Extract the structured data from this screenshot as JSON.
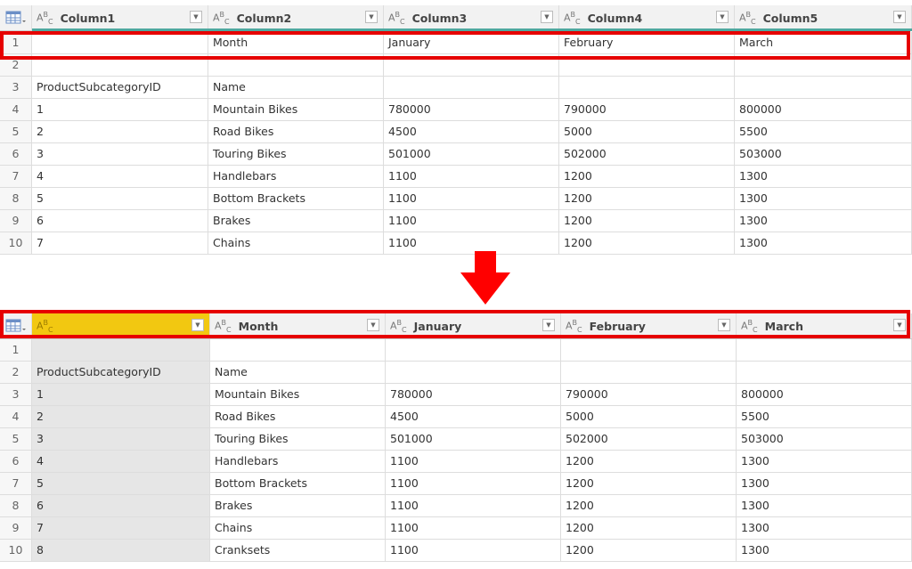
{
  "before": {
    "columns": [
      {
        "type_icon": "abc-text-type-icon",
        "name": "Column1"
      },
      {
        "type_icon": "abc-text-type-icon",
        "name": "Column2"
      },
      {
        "type_icon": "abc-text-type-icon",
        "name": "Column3"
      },
      {
        "type_icon": "abc-text-type-icon",
        "name": "Column4"
      },
      {
        "type_icon": "abc-text-type-icon",
        "name": "Column5"
      }
    ],
    "rows": [
      {
        "n": "1",
        "c": [
          "",
          "Month",
          "January",
          "February",
          "March"
        ]
      },
      {
        "n": "2",
        "c": [
          "",
          "",
          "",
          "",
          ""
        ]
      },
      {
        "n": "3",
        "c": [
          "ProductSubcategoryID",
          "Name",
          "",
          "",
          ""
        ]
      },
      {
        "n": "4",
        "c": [
          "1",
          "Mountain Bikes",
          "780000",
          "790000",
          "800000"
        ]
      },
      {
        "n": "5",
        "c": [
          "2",
          "Road Bikes",
          "4500",
          "5000",
          "5500"
        ]
      },
      {
        "n": "6",
        "c": [
          "3",
          "Touring Bikes",
          "501000",
          "502000",
          "503000"
        ]
      },
      {
        "n": "7",
        "c": [
          "4",
          "Handlebars",
          "1100",
          "1200",
          "1300"
        ]
      },
      {
        "n": "8",
        "c": [
          "5",
          "Bottom Brackets",
          "1100",
          "1200",
          "1300"
        ]
      },
      {
        "n": "9",
        "c": [
          "6",
          "Brakes",
          "1100",
          "1200",
          "1300"
        ]
      },
      {
        "n": "10",
        "c": [
          "7",
          "Chains",
          "1100",
          "1200",
          "1300"
        ]
      }
    ]
  },
  "after": {
    "columns": [
      {
        "type_icon": "abc-text-type-icon",
        "name": ""
      },
      {
        "type_icon": "abc-text-type-icon",
        "name": "Month"
      },
      {
        "type_icon": "abc-text-type-icon",
        "name": "January"
      },
      {
        "type_icon": "abc-text-type-icon",
        "name": "February"
      },
      {
        "type_icon": "abc-text-type-icon",
        "name": "March"
      }
    ],
    "rows": [
      {
        "n": "1",
        "c": [
          "",
          "",
          "",
          "",
          ""
        ]
      },
      {
        "n": "2",
        "c": [
          "ProductSubcategoryID",
          "Name",
          "",
          "",
          ""
        ]
      },
      {
        "n": "3",
        "c": [
          "1",
          "Mountain Bikes",
          "780000",
          "790000",
          "800000"
        ]
      },
      {
        "n": "4",
        "c": [
          "2",
          "Road Bikes",
          "4500",
          "5000",
          "5500"
        ]
      },
      {
        "n": "5",
        "c": [
          "3",
          "Touring Bikes",
          "501000",
          "502000",
          "503000"
        ]
      },
      {
        "n": "6",
        "c": [
          "4",
          "Handlebars",
          "1100",
          "1200",
          "1300"
        ]
      },
      {
        "n": "7",
        "c": [
          "5",
          "Bottom Brackets",
          "1100",
          "1200",
          "1300"
        ]
      },
      {
        "n": "8",
        "c": [
          "6",
          "Brakes",
          "1100",
          "1200",
          "1300"
        ]
      },
      {
        "n": "9",
        "c": [
          "7",
          "Chains",
          "1100",
          "1200",
          "1300"
        ]
      },
      {
        "n": "10",
        "c": [
          "8",
          "Cranksets",
          "1100",
          "1200",
          "1300"
        ]
      }
    ]
  },
  "colors": {
    "highlight": "#e60000",
    "selected_column": "#f2c811",
    "quality_bar": "#4fa8a0"
  },
  "annotation": {
    "arrow_icon": "down-arrow-icon"
  }
}
